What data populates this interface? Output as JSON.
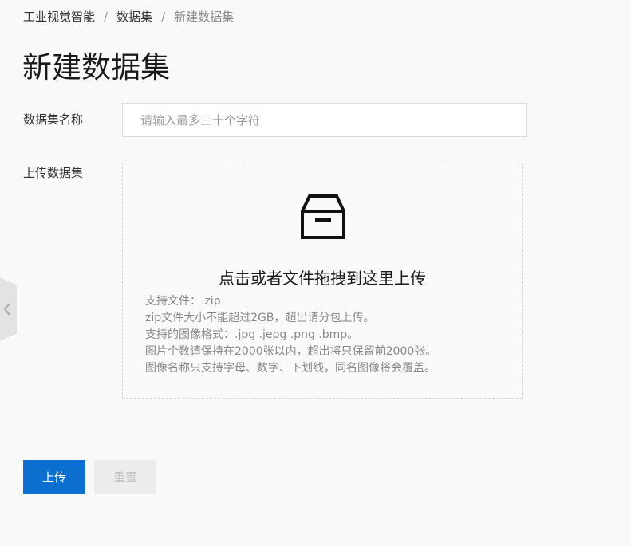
{
  "breadcrumb": {
    "items": [
      "工业视觉智能",
      "数据集"
    ],
    "current": "新建数据集",
    "separator": "/"
  },
  "page": {
    "title": "新建数据集"
  },
  "form": {
    "name_label": "数据集名称",
    "name_placeholder": "请输入最多三十个字符",
    "name_value": "",
    "upload_label": "上传数据集"
  },
  "dropzone": {
    "icon": "archive-box-icon",
    "title": "点击或者文件拖拽到这里上传",
    "hints": [
      "支持文件：.zip",
      "zip文件大小不能超过2GB，超出请分包上传。",
      "支持的图像格式：.jpg .jepg .png .bmp。",
      "图片个数请保持在2000张以内，超出将只保留前2000张。",
      "图像名称只支持字母、数字、下划线，同名图像将会覆盖。"
    ]
  },
  "actions": {
    "upload_label": "上传",
    "reset_label": "重置"
  },
  "side_toggle": {
    "icon": "chevron-left-icon"
  },
  "colors": {
    "primary": "#0a6fce",
    "background": "#f9f9f9",
    "disabled_text": "#c4c4c4"
  }
}
